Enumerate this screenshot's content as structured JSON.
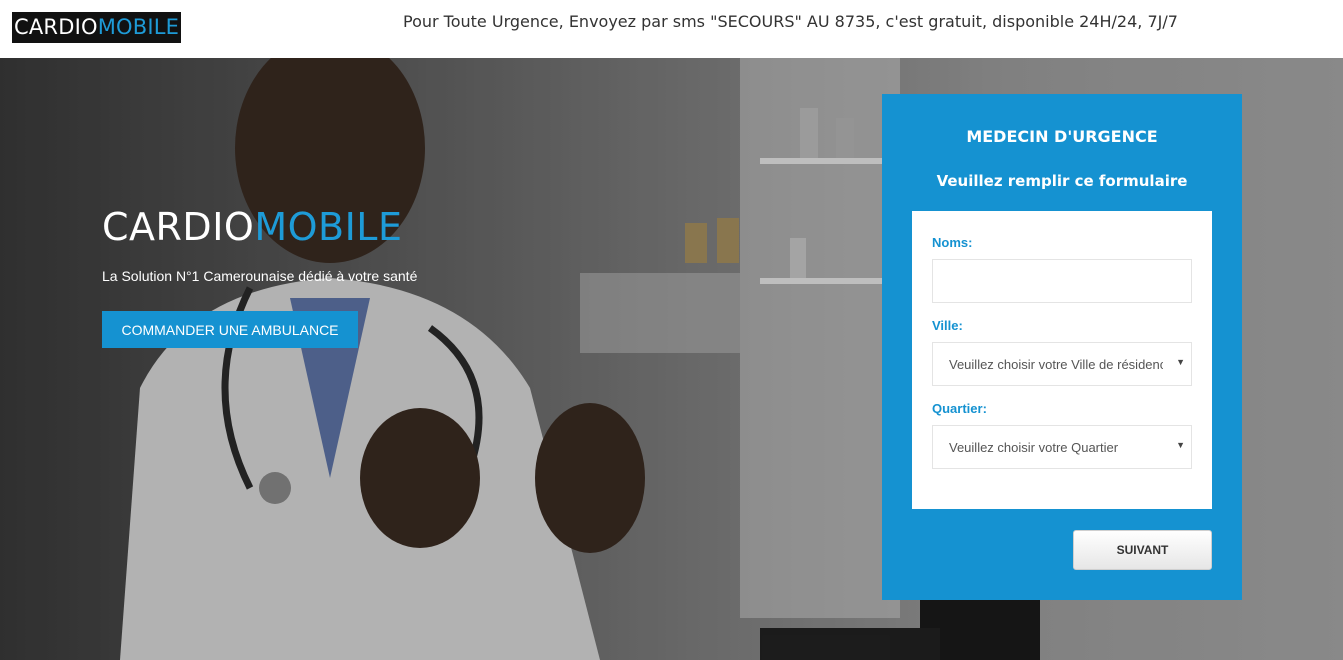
{
  "header": {
    "logo_part1": "CARDIO",
    "logo_part2": "MOBILE",
    "notice": "Pour Toute Urgence, Envoyez par sms \"SECOURS\" AU 8735, c'est gratuit, disponible 24H/24, 7J/7"
  },
  "hero": {
    "brand_part1": "CARDIO",
    "brand_part2": "MOBILE",
    "tagline": "La Solution N°1 Camerounaise dédié à votre santé",
    "cta_label": "COMMANDER UNE AMBULANCE"
  },
  "form": {
    "title": "MEDECIN D'URGENCE",
    "subtitle": "Veuillez remplir ce formulaire",
    "fields": {
      "noms_label": "Noms:",
      "noms_value": "",
      "ville_label": "Ville:",
      "ville_selected": "Veuillez choisir votre Ville de résidence",
      "quartier_label": "Quartier:",
      "quartier_selected": "Veuillez choisir votre Quartier"
    },
    "submit_label": "SUIVANT"
  },
  "colors": {
    "brand_blue": "#1592d1",
    "logo_bg": "#111111",
    "text_dark": "#333333"
  }
}
